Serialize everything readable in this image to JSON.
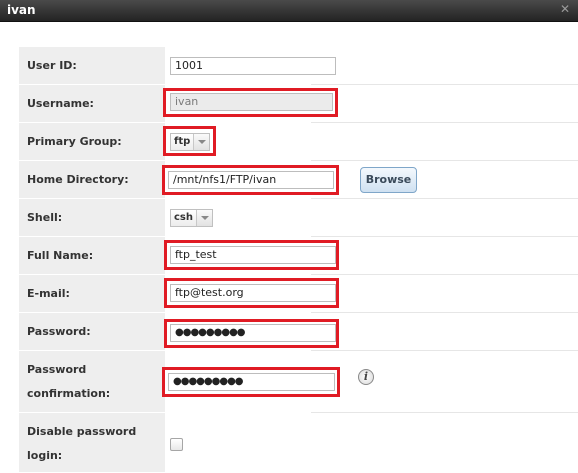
{
  "window": {
    "title": "ivan",
    "close_glyph": "✕"
  },
  "fields": {
    "user_id": {
      "label": "User ID:",
      "value": "1001"
    },
    "username": {
      "label": "Username:",
      "value": "ivan"
    },
    "primary_group": {
      "label": "Primary Group:",
      "value": "ftp"
    },
    "home_directory": {
      "label": "Home Directory:",
      "value": "/mnt/nfs1/FTP/ivan",
      "button": "Browse"
    },
    "shell": {
      "label": "Shell:",
      "value": "csh"
    },
    "full_name": {
      "label": "Full Name:",
      "value": "ftp_test"
    },
    "email": {
      "label": "E-mail:",
      "value": "ftp@test.org"
    },
    "password": {
      "label": "Password:",
      "value": "●●●●●●●●●"
    },
    "password_confirmation": {
      "label_line1": "Password",
      "label_line2": "confirmation:",
      "value": "●●●●●●●●●",
      "info_glyph": "i"
    },
    "disable_password_login": {
      "label_line1": "Disable password",
      "label_line2": "login:",
      "checked": false
    }
  },
  "colors": {
    "highlight": "#e01b24",
    "label_bg": "#eeeeee",
    "titlebar": "#2b2b2b"
  }
}
